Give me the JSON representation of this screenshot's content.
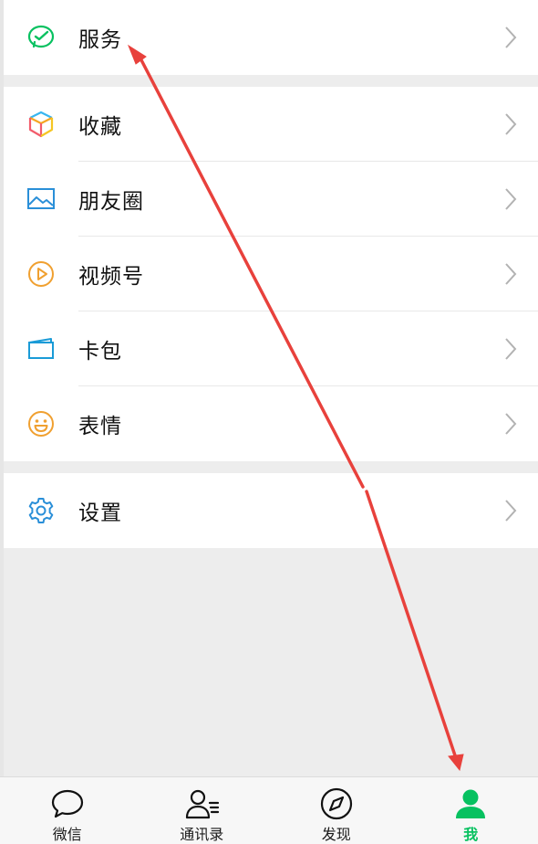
{
  "menu": {
    "services": {
      "label": "服务",
      "icon": "wechat-pay-icon"
    },
    "group2": [
      {
        "label": "收藏",
        "icon": "favorites-cube-icon"
      },
      {
        "label": "朋友圈",
        "icon": "moments-image-icon"
      },
      {
        "label": "视频号",
        "icon": "channels-play-icon"
      },
      {
        "label": "卡包",
        "icon": "card-wallet-icon"
      },
      {
        "label": "表情",
        "icon": "sticker-smile-icon"
      }
    ],
    "settings": {
      "label": "设置",
      "icon": "gear-icon"
    }
  },
  "tabbar": {
    "tabs": [
      {
        "label": "微信",
        "icon": "chat-bubble-icon"
      },
      {
        "label": "通讯录",
        "icon": "contacts-icon"
      },
      {
        "label": "发现",
        "icon": "compass-icon"
      },
      {
        "label": "我",
        "icon": "person-icon",
        "active": true
      }
    ]
  },
  "colors": {
    "accent": "#07c160",
    "arrow": "#e8413c",
    "background": "#ededed"
  }
}
